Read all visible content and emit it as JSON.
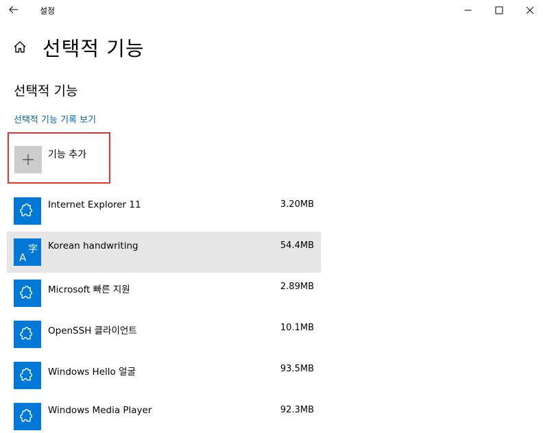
{
  "window": {
    "title": "설정"
  },
  "header": {
    "title": "선택적 기능"
  },
  "section": {
    "title": "선택적 기능",
    "history_link": "선택적 기능 기록 보기"
  },
  "add_feature": {
    "label": "기능 추가"
  },
  "features": [
    {
      "name": "Internet Explorer 11",
      "size": "3.20MB",
      "icon": "puzzle-icon",
      "selected": false
    },
    {
      "name": "Korean handwriting",
      "size": "54.4MB",
      "icon": "language-icon",
      "selected": true
    },
    {
      "name": "Microsoft 빠른 지원",
      "size": "2.89MB",
      "icon": "puzzle-icon",
      "selected": false
    },
    {
      "name": "OpenSSH 클라이언트",
      "size": "10.1MB",
      "icon": "puzzle-icon",
      "selected": false
    },
    {
      "name": "Windows Hello 얼굴",
      "size": "93.5MB",
      "icon": "puzzle-icon",
      "selected": false
    },
    {
      "name": "Windows Media Player",
      "size": "92.3MB",
      "icon": "puzzle-icon",
      "selected": false
    }
  ],
  "colors": {
    "accent": "#0078d7",
    "link": "#0067b8",
    "highlight_border": "#e8312a",
    "selected_row": "#e6e6e6",
    "add_tile": "#cccccc"
  }
}
